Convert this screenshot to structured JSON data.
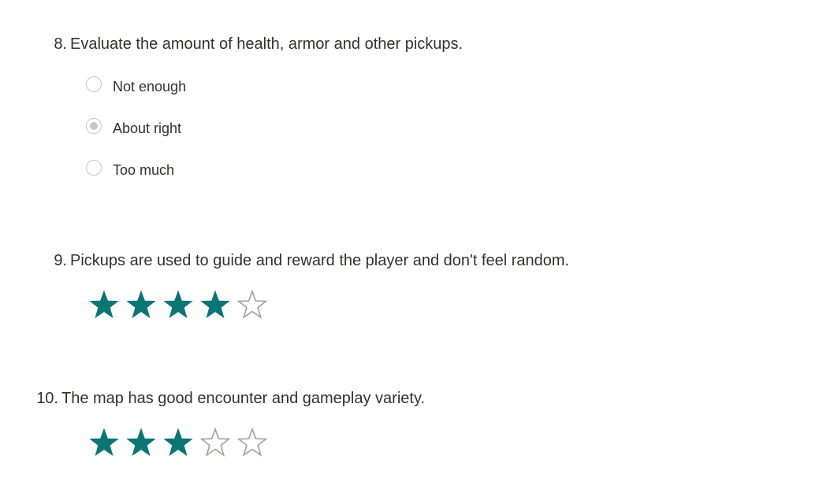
{
  "questions": [
    {
      "number": "8.",
      "title": "Evaluate the amount of health, armor and other pickups.",
      "type": "choice",
      "options": [
        "Not enough",
        "About right",
        "Too much"
      ],
      "selected": "About right"
    },
    {
      "number": "9.",
      "title": "Pickups are used to guide and reward the player and don't feel random.",
      "type": "rating",
      "rating": 4,
      "max": 5
    },
    {
      "number": "10.",
      "title": "The map has good encounter and gameplay variety.",
      "type": "rating",
      "rating": 3,
      "max": 5
    }
  ],
  "colors": {
    "star_filled": "#077675",
    "star_empty_stroke": "#a19f9d",
    "radio_border": "#c8c6c4",
    "text": "#323130"
  },
  "icons": {
    "radio": "radio-button-icon",
    "star_filled": "star-filled-icon",
    "star_empty": "star-outline-icon"
  }
}
